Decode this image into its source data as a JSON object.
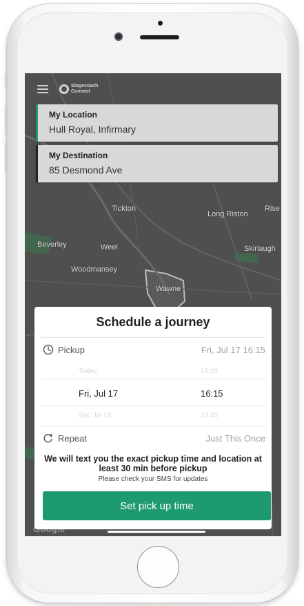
{
  "map": {
    "labels": [
      {
        "text": "Beverley"
      },
      {
        "text": "Woodmansey"
      },
      {
        "text": "Wawne"
      },
      {
        "text": "Tickton"
      },
      {
        "text": "Long Riston"
      },
      {
        "text": "Skirlaugh"
      },
      {
        "text": "Rise"
      },
      {
        "text": "Weel"
      }
    ],
    "attribution": "Google"
  },
  "header": {
    "brand_name_line1": "Stagecoach",
    "brand_name_line2": "Connect"
  },
  "origin": {
    "title": "My Location",
    "value": "Hull Royal, Infirmary"
  },
  "destination": {
    "title": "My Destination",
    "value": "85 Desmond Ave"
  },
  "sheet": {
    "title": "Schedule a journey",
    "pickup_label": "Pickup",
    "pickup_value": "Fri, Jul 17 16:15",
    "picker": {
      "prev_date": "Today",
      "prev_time": "15:15",
      "selected_date": "Fri, Jul 17",
      "selected_time": "16:15",
      "next_date": "Sat, Jul 18",
      "next_time": "19:45"
    },
    "repeat_label": "Repeat",
    "repeat_value": "Just This Once",
    "notice_main": "We will text you the exact pickup time and location at least 30 min before pickup",
    "notice_sub": "Please check your SMS for updates",
    "button_label": "Set pick up time"
  },
  "colors": {
    "accent": "#1e9a70",
    "map_background": "#4f4f4f"
  },
  "icons": {
    "menu": "hamburger-menu-icon",
    "pickup": "clock-icon",
    "repeat": "repeat-icon"
  }
}
